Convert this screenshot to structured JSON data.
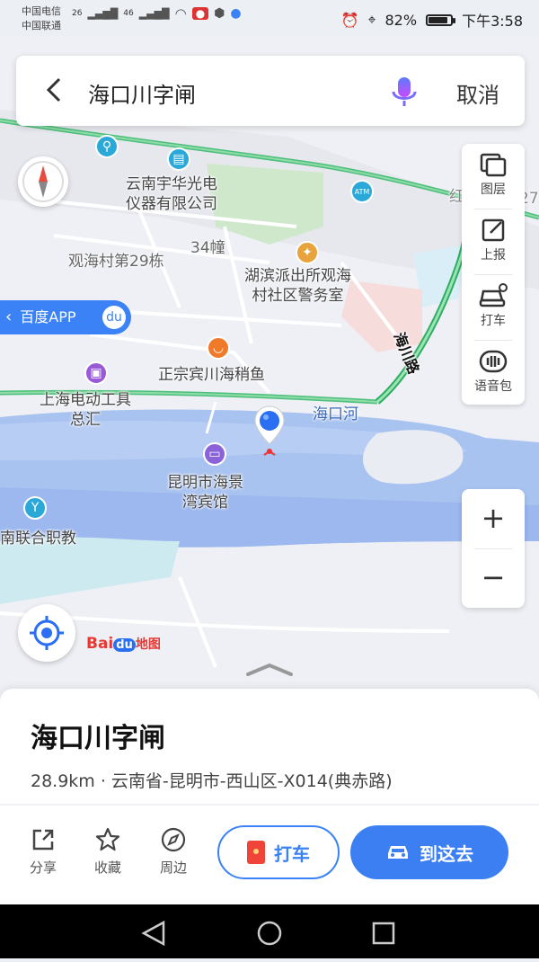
{
  "status": {
    "carrier1": "中国电信",
    "carrier2": "中国联通",
    "sig1": "26",
    "sig2": "46",
    "battery": "82%",
    "battery_level": 0.82,
    "time": "下午3:58"
  },
  "search": {
    "query": "海口川字闸",
    "cancel": "取消"
  },
  "tools": [
    {
      "label": "图层",
      "icon": "layers-icon"
    },
    {
      "label": "上报",
      "icon": "report-icon"
    },
    {
      "label": "打车",
      "icon": "taxi-icon"
    },
    {
      "label": "语音包",
      "icon": "voice-pack-icon"
    }
  ],
  "zoom": {
    "in": "+",
    "out": "−"
  },
  "baidu_app": "百度APP",
  "map_labels": {
    "yunnan_yuhua": "云南宇华光电\n仪器有限公司",
    "guanhai_village": "观海村第29栋",
    "building34": "34幢",
    "police": "湖滨派出所观海\n村社区警务室",
    "fish": "正宗宾川海稍鱼",
    "electric": "上海电动工具\n总汇",
    "river": "海口河",
    "road": "海川路",
    "hotel": "昆明市海景\n湾宾馆",
    "school": "南联合职教",
    "edge_red": "红",
    "edge_num": "27",
    "atm": "ATM"
  },
  "logo": {
    "bai": "Bai",
    "du": "du",
    "map": "地图"
  },
  "card": {
    "title": "海口川字闸",
    "address": "28.9km · 云南省-昆明市-西山区-X014(典赤路)",
    "actions": [
      {
        "label": "分享",
        "icon": "share-icon"
      },
      {
        "label": "收藏",
        "icon": "star-icon"
      },
      {
        "label": "周边",
        "icon": "compass-icon"
      }
    ],
    "taxi": "打车",
    "goto": "到这去"
  }
}
